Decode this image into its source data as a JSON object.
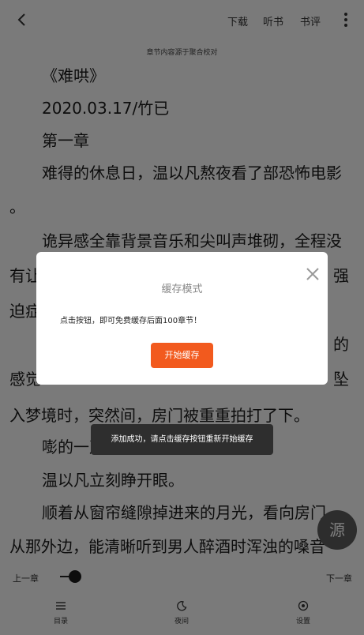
{
  "header": {
    "actions": [
      "下载",
      "听书",
      "书评"
    ]
  },
  "source_note": "章节内容源于聚合校对",
  "reader": {
    "lines": [
      "《难哄》",
      "2020.03.17/竹已",
      "第一章",
      "难得的休息日，温以凡熬夜看了部恐怖电影",
      "。",
      "诡异感全靠背景音乐和尖叫声堆砌，全程没",
      "有让",
      "迫症",
      "感觉",
      "入梦境时，突然间，房门被重重拍打了下。",
      "嘭的一声",
      "温以凡立刻睁开眼。",
      "顺着从窗帘缝隙掉进来的月光，看向房门",
      "从那外边，能清晰听到男人醉酒时浑浊的嗓音"
    ],
    "partial_right": [
      "强",
      "的",
      "坠"
    ]
  },
  "progress": {
    "prev_label": "上一章",
    "next_label": "下一章",
    "value": 0.02
  },
  "bottom_nav": {
    "items": [
      "目录",
      "夜间",
      "设置"
    ]
  },
  "source_button": "源",
  "dialog": {
    "title": "缓存模式",
    "message": "点击按钮，即可免费缓存后面100章节！",
    "button": "开始缓存"
  },
  "toast": "添加成功，请点击缓存按钮重新开始缓存",
  "colors": {
    "accent": "#f25a1e",
    "overlay": "rgba(0,0,0,0.5)"
  }
}
